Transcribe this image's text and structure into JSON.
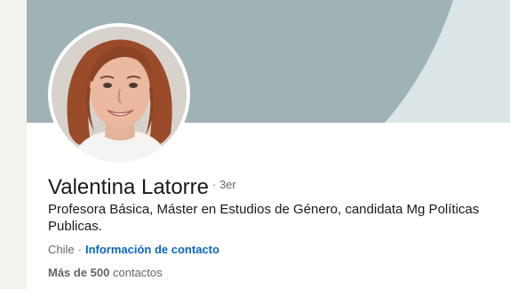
{
  "profile": {
    "name": "Valentina Latorre",
    "degree": "· 3er",
    "headline": "Profesora Básica, Máster en Estudios de Género, candidata Mg Políticas Publicas.",
    "location": "Chile",
    "location_separator": "·",
    "contact_info_label": "Información de contacto",
    "connections_count": "Más de 500",
    "connections_label": "contactos"
  },
  "colors": {
    "banner_light": "#dbe5e7",
    "banner_dark": "#9fb3b7",
    "link": "#0a66c2"
  }
}
